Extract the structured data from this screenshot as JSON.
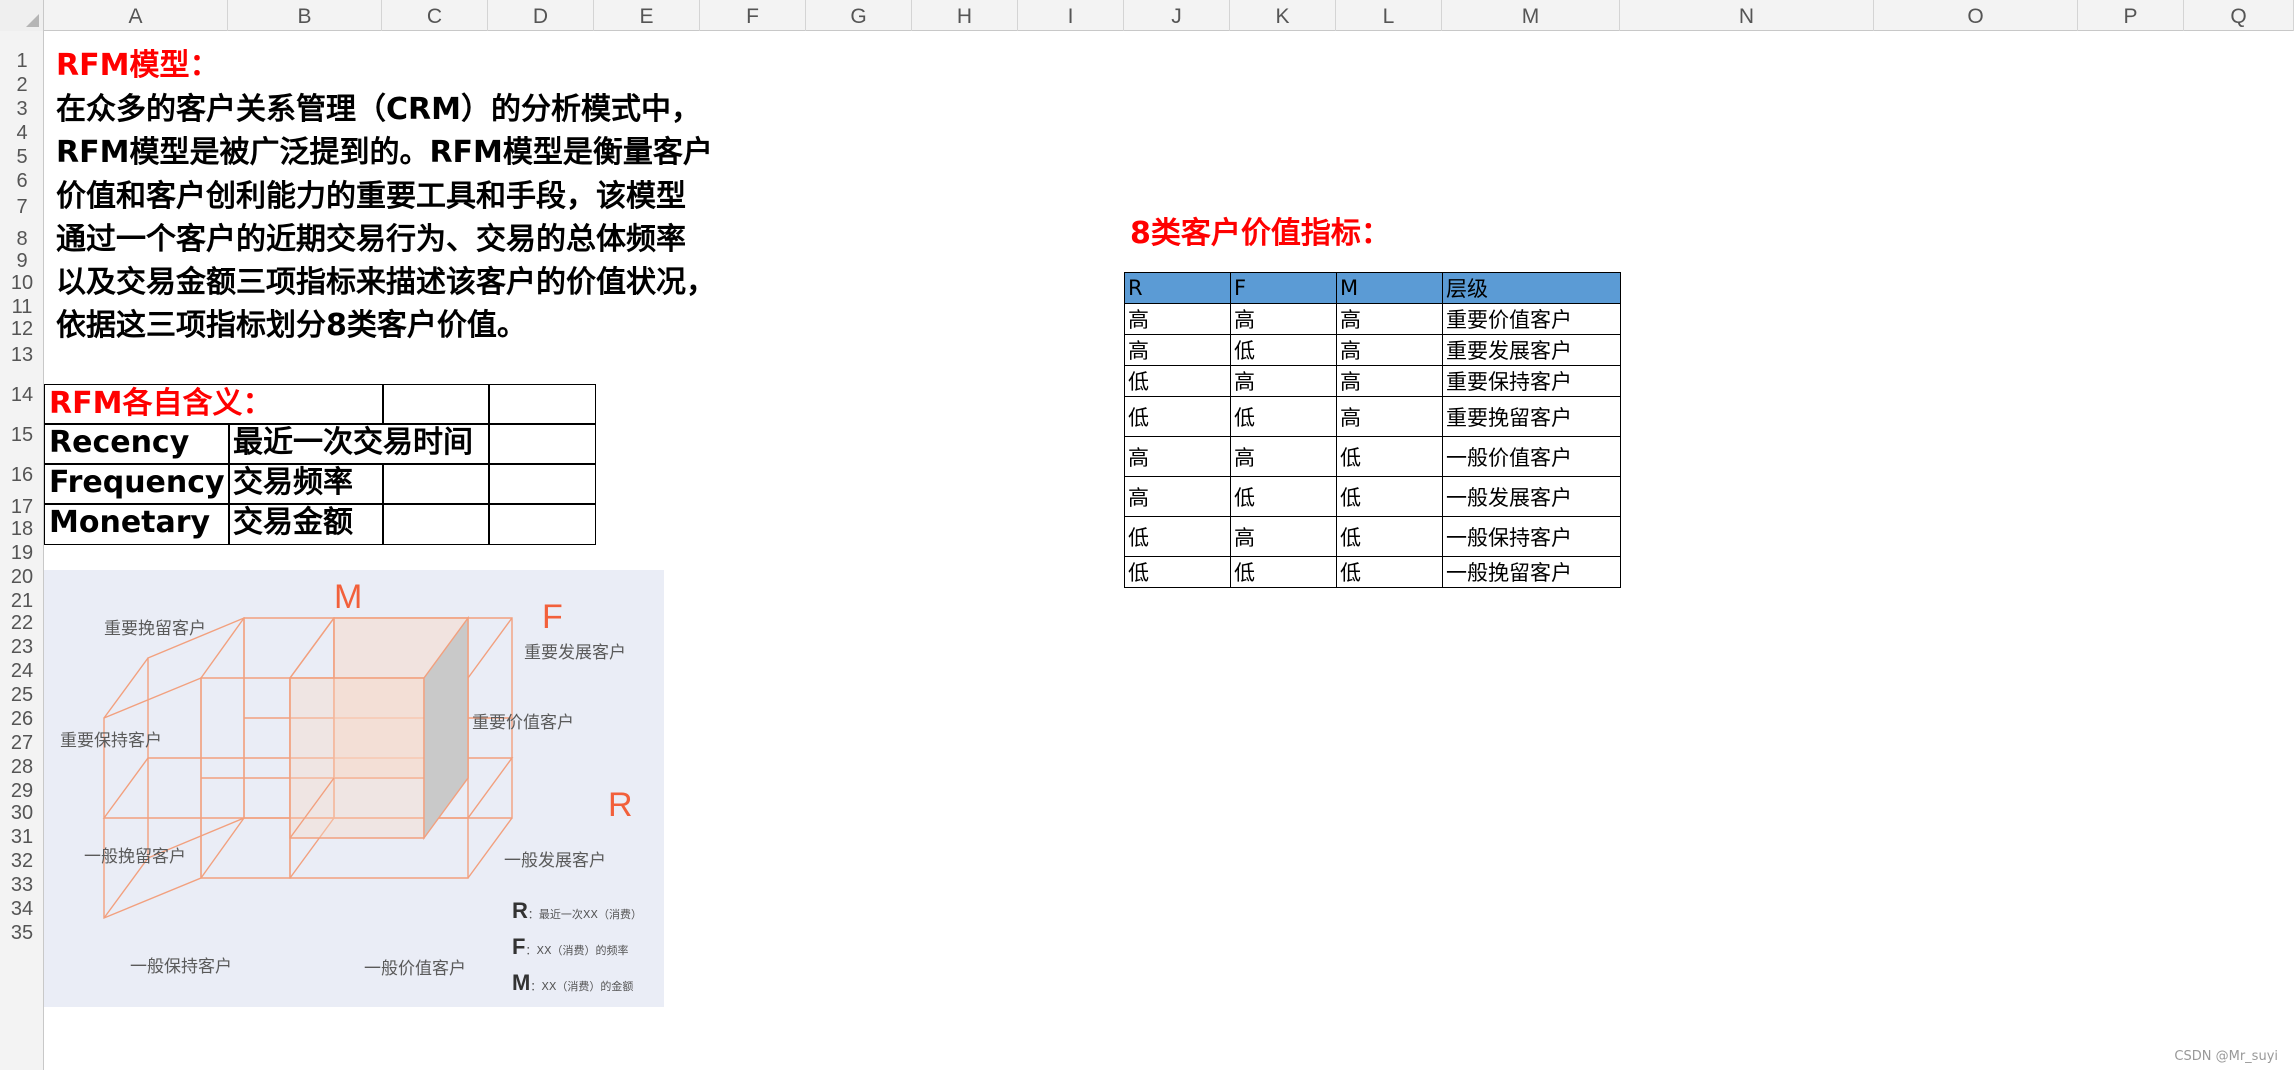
{
  "columns": [
    "A",
    "B",
    "C",
    "D",
    "E",
    "F",
    "G",
    "H",
    "I",
    "J",
    "K",
    "L",
    "M",
    "N",
    "O",
    "P",
    "Q"
  ],
  "rows": [
    "1",
    "2",
    "3",
    "4",
    "5",
    "6",
    "7",
    "8",
    "9",
    "10",
    "11",
    "12",
    "13",
    "14",
    "15",
    "16",
    "17",
    "18",
    "19",
    "20",
    "21",
    "22",
    "23",
    "24",
    "25",
    "26",
    "27",
    "28",
    "29",
    "30",
    "31",
    "32",
    "33",
    "34",
    "35"
  ],
  "intro": {
    "title": "RFM模型：",
    "lines": [
      "在众多的客户关系管理（CRM）的分析模式中，",
      "RFM模型是被广泛提到的。RFM模型是衡量客户",
      "价值和客户创利能力的重要工具和手段，该模型",
      "通过一个客户的近期交易行为、交易的总体频率",
      "以及交易金额三项指标来描述该客户的价值状况，",
      "依据这三项指标划分8类客户价值。"
    ]
  },
  "meaning_table": {
    "title": "RFM各自含义：",
    "rows": [
      {
        "term": "Recency",
        "meaning": "最近一次交易时间"
      },
      {
        "term": "Frequency",
        "meaning": "交易频率"
      },
      {
        "term": "Monetary",
        "meaning": "交易金额"
      }
    ]
  },
  "cube_diagram": {
    "axes": {
      "m": "M",
      "f": "F",
      "r": "R"
    },
    "labels": {
      "important_retain": "重要挽留客户",
      "important_develop": "重要发展客户",
      "important_keep": "重要保持客户",
      "important_value": "重要价值客户",
      "general_retain": "一般挽留客户",
      "general_develop": "一般发展客户",
      "general_keep": "一般保持客户",
      "general_value": "一般价值客户"
    },
    "legend": [
      {
        "letter": "R",
        "desc": "：最近一次XX（消费）"
      },
      {
        "letter": "F",
        "desc": "：XX（消费）的频率"
      },
      {
        "letter": "M",
        "desc": "：XX（消费）的金额"
      }
    ],
    "colors": {
      "background": "#eaedf6",
      "line": "#f2a07e",
      "accent": "#f2603b",
      "shade": "#c9c9c9"
    }
  },
  "value_table": {
    "title": "8类客户价值指标：",
    "headers": [
      "R",
      "F",
      "M",
      "层级"
    ],
    "rows": [
      [
        "高",
        "高",
        "高",
        "重要价值客户"
      ],
      [
        "高",
        "低",
        "高",
        "重要发展客户"
      ],
      [
        "低",
        "高",
        "高",
        "重要保持客户"
      ],
      [
        "低",
        "低",
        "高",
        "重要挽留客户"
      ],
      [
        "高",
        "高",
        "低",
        "一般价值客户"
      ],
      [
        "高",
        "低",
        "低",
        "一般发展客户"
      ],
      [
        "低",
        "高",
        "低",
        "一般保持客户"
      ],
      [
        "低",
        "低",
        "低",
        "一般挽留客户"
      ]
    ],
    "header_color": "#5b9bd5"
  },
  "watermark": "CSDN @Mr_suyi"
}
